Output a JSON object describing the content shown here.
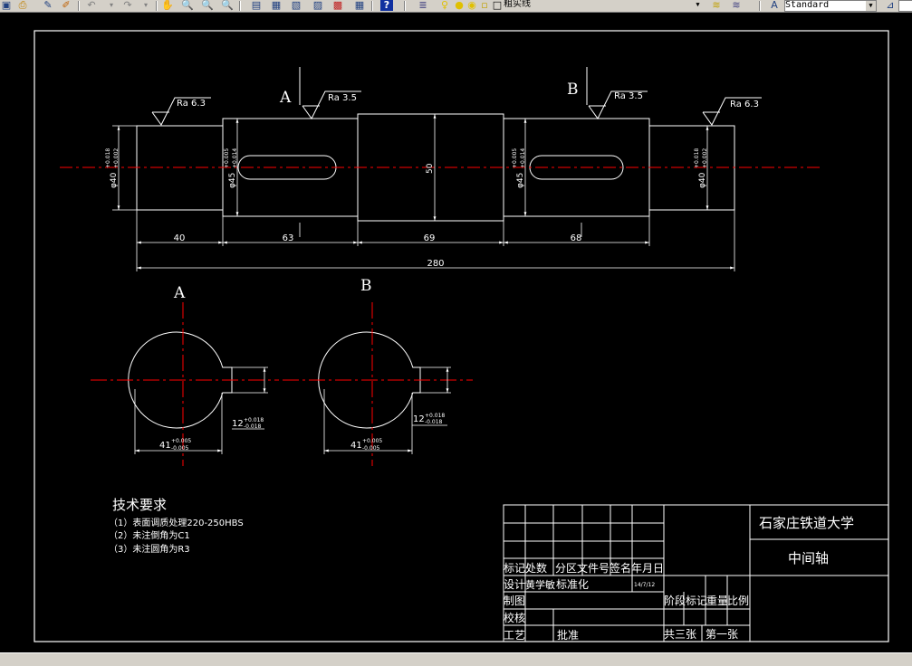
{
  "toolbar": {
    "icons": [
      "save-icon",
      "print-icon",
      "pen-icon",
      "brush-icon",
      "undo-icon",
      "redo-icon",
      "pan-icon",
      "zoom-realtime-icon",
      "zoom-window-icon",
      "zoom-previous-icon",
      "properties-icon",
      "design-center-icon",
      "tool-palette-icon",
      "sheet-set-icon",
      "markup-icon",
      "calculator-icon",
      "help-icon",
      "layer-manager-icon",
      "bulb-icon",
      "sun-icon",
      "freeze-icon",
      "lock-icon",
      "color-icon"
    ],
    "layer_name": "粗实线",
    "text_style": "Standard"
  },
  "drawing": {
    "section_labels": {
      "a": "A",
      "b": "B",
      "view_a": "A",
      "view_b": "B"
    },
    "roughness": {
      "left": "Ra 6.3",
      "section_a": "Ra 3.5",
      "section_b": "Ra 3.5",
      "right": "Ra 6.3"
    },
    "diameters": {
      "seg1": "φ40",
      "seg1_tol_up": "+0.018",
      "seg1_tol_low": "+0.002",
      "seg2": "φ45",
      "seg2_tol_up": "+0.005",
      "seg2_tol_low": "+0.014",
      "seg3": "50",
      "seg4": "φ45",
      "seg4_tol_up": "+0.005",
      "seg4_tol_low": "+0.014",
      "seg5": "φ40",
      "seg5_tol_up": "+0.018",
      "seg5_tol_low": "+0.002"
    },
    "lengths": {
      "seg1": "40",
      "seg2": "63",
      "seg3": "69",
      "seg4": "68",
      "total": "280"
    },
    "section_dims": {
      "a_width": "41",
      "a_width_tol_up": "+0.005",
      "a_width_tol_low": "-0.005",
      "a_key": "12",
      "a_key_tol_up": "+0.018",
      "a_key_tol_low": "-0.018",
      "b_width": "41",
      "b_width_tol_up": "+0.005",
      "b_width_tol_low": "-0.005",
      "b_key": "12",
      "b_key_tol_up": "+0.018",
      "b_key_tol_low": "-0.018"
    },
    "tech_requirements": {
      "title": "技术要求",
      "item1": "（1）表面调质处理220-250HBS",
      "item2": "（2）未注倒角为C1",
      "item3": "（3）未注圆角为R3"
    }
  },
  "title_block": {
    "school": "石家庄铁道大学",
    "part_name": "中间轴",
    "hdr_mark": "标记",
    "hdr_count": "处数",
    "hdr_zone": "分区",
    "hdr_docno": "文件号",
    "hdr_sign": "签名",
    "hdr_date": "年月日",
    "design": "设计",
    "designer": "黄学敏",
    "standardize": "标准化",
    "design_date": "14/7/12",
    "drawn": "制图",
    "check": "校核",
    "process": "工艺",
    "approve": "批准",
    "stage_mark": "阶段标记",
    "weight": "重量",
    "scale": "比例",
    "sheet_total": "共三张",
    "sheet_no": "第一张"
  },
  "colors": {
    "background": "#000000",
    "outline": "#ffffff",
    "centerline": "#ff0000",
    "toolbar": "#d4d0c8"
  }
}
